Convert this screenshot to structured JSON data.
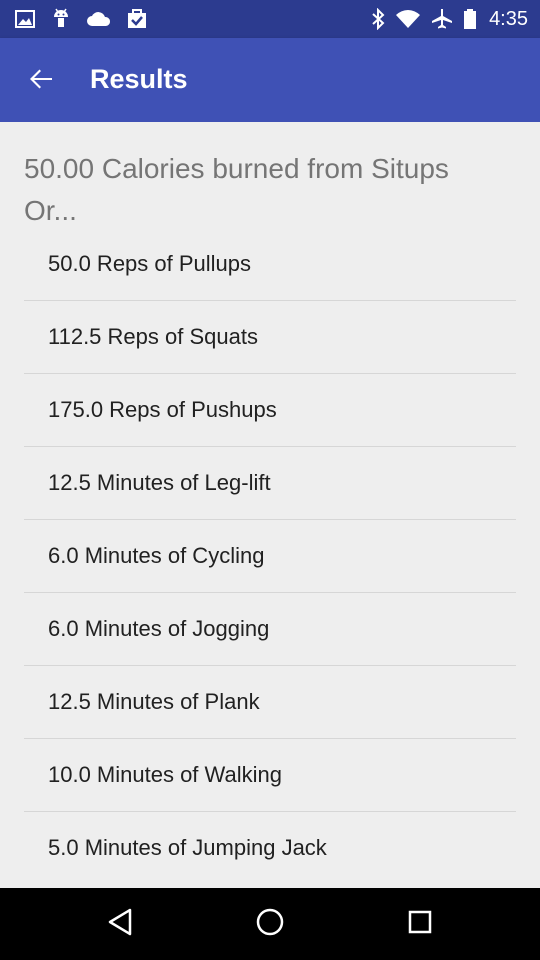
{
  "status_bar": {
    "time": "4:35",
    "left_icons": [
      "gallery-icon",
      "android-icon",
      "cloud-icon",
      "briefcase-icon"
    ],
    "right_icons": [
      "bluetooth-icon",
      "wifi-icon",
      "airplane-icon",
      "battery-icon"
    ]
  },
  "app_bar": {
    "title": "Results",
    "back_icon": "arrow-back-icon",
    "color": "#3f51b5",
    "status_color": "#2c3b8f"
  },
  "summary": {
    "line1": "50.00 Calories burned from Situps",
    "line2": "Or..."
  },
  "results": [
    "50.0 Reps of Pullups",
    "112.5 Reps of Squats",
    "175.0 Reps of Pushups",
    "12.5 Minutes of Leg-lift",
    "6.0 Minutes of Cycling",
    "6.0 Minutes of Jogging",
    "12.5 Minutes of Plank",
    "10.0 Minutes of Walking",
    "5.0 Minutes of Jumping Jack"
  ],
  "nav_bar": {
    "buttons": [
      "back-triangle-icon",
      "home-circle-icon",
      "recents-square-icon"
    ]
  }
}
